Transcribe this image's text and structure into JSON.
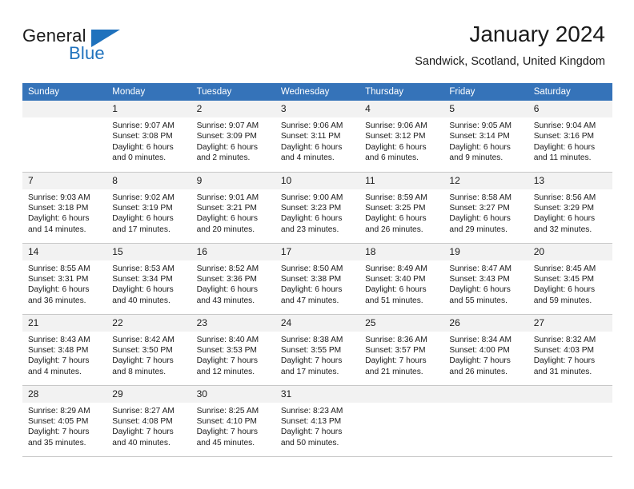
{
  "brand": {
    "name_part1": "General",
    "name_part2": "Blue",
    "flag_icon": "triangle-flag-icon"
  },
  "header": {
    "month_title": "January 2024",
    "location": "Sandwick, Scotland, United Kingdom"
  },
  "colors": {
    "header_blue": "#3573b9",
    "brand_blue": "#1f72bd",
    "daynum_bg": "#f2f2f2",
    "grid_line": "#c8c8c8",
    "text": "#1a1a1a"
  },
  "calendar": {
    "weekday_headers": [
      "Sunday",
      "Monday",
      "Tuesday",
      "Wednesday",
      "Thursday",
      "Friday",
      "Saturday"
    ],
    "weeks": [
      [
        {
          "day": "",
          "sunrise": "",
          "sunset": "",
          "daylight_line1": "",
          "daylight_line2": ""
        },
        {
          "day": "1",
          "sunrise": "Sunrise: 9:07 AM",
          "sunset": "Sunset: 3:08 PM",
          "daylight_line1": "Daylight: 6 hours",
          "daylight_line2": "and 0 minutes."
        },
        {
          "day": "2",
          "sunrise": "Sunrise: 9:07 AM",
          "sunset": "Sunset: 3:09 PM",
          "daylight_line1": "Daylight: 6 hours",
          "daylight_line2": "and 2 minutes."
        },
        {
          "day": "3",
          "sunrise": "Sunrise: 9:06 AM",
          "sunset": "Sunset: 3:11 PM",
          "daylight_line1": "Daylight: 6 hours",
          "daylight_line2": "and 4 minutes."
        },
        {
          "day": "4",
          "sunrise": "Sunrise: 9:06 AM",
          "sunset": "Sunset: 3:12 PM",
          "daylight_line1": "Daylight: 6 hours",
          "daylight_line2": "and 6 minutes."
        },
        {
          "day": "5",
          "sunrise": "Sunrise: 9:05 AM",
          "sunset": "Sunset: 3:14 PM",
          "daylight_line1": "Daylight: 6 hours",
          "daylight_line2": "and 9 minutes."
        },
        {
          "day": "6",
          "sunrise": "Sunrise: 9:04 AM",
          "sunset": "Sunset: 3:16 PM",
          "daylight_line1": "Daylight: 6 hours",
          "daylight_line2": "and 11 minutes."
        }
      ],
      [
        {
          "day": "7",
          "sunrise": "Sunrise: 9:03 AM",
          "sunset": "Sunset: 3:18 PM",
          "daylight_line1": "Daylight: 6 hours",
          "daylight_line2": "and 14 minutes."
        },
        {
          "day": "8",
          "sunrise": "Sunrise: 9:02 AM",
          "sunset": "Sunset: 3:19 PM",
          "daylight_line1": "Daylight: 6 hours",
          "daylight_line2": "and 17 minutes."
        },
        {
          "day": "9",
          "sunrise": "Sunrise: 9:01 AM",
          "sunset": "Sunset: 3:21 PM",
          "daylight_line1": "Daylight: 6 hours",
          "daylight_line2": "and 20 minutes."
        },
        {
          "day": "10",
          "sunrise": "Sunrise: 9:00 AM",
          "sunset": "Sunset: 3:23 PM",
          "daylight_line1": "Daylight: 6 hours",
          "daylight_line2": "and 23 minutes."
        },
        {
          "day": "11",
          "sunrise": "Sunrise: 8:59 AM",
          "sunset": "Sunset: 3:25 PM",
          "daylight_line1": "Daylight: 6 hours",
          "daylight_line2": "and 26 minutes."
        },
        {
          "day": "12",
          "sunrise": "Sunrise: 8:58 AM",
          "sunset": "Sunset: 3:27 PM",
          "daylight_line1": "Daylight: 6 hours",
          "daylight_line2": "and 29 minutes."
        },
        {
          "day": "13",
          "sunrise": "Sunrise: 8:56 AM",
          "sunset": "Sunset: 3:29 PM",
          "daylight_line1": "Daylight: 6 hours",
          "daylight_line2": "and 32 minutes."
        }
      ],
      [
        {
          "day": "14",
          "sunrise": "Sunrise: 8:55 AM",
          "sunset": "Sunset: 3:31 PM",
          "daylight_line1": "Daylight: 6 hours",
          "daylight_line2": "and 36 minutes."
        },
        {
          "day": "15",
          "sunrise": "Sunrise: 8:53 AM",
          "sunset": "Sunset: 3:34 PM",
          "daylight_line1": "Daylight: 6 hours",
          "daylight_line2": "and 40 minutes."
        },
        {
          "day": "16",
          "sunrise": "Sunrise: 8:52 AM",
          "sunset": "Sunset: 3:36 PM",
          "daylight_line1": "Daylight: 6 hours",
          "daylight_line2": "and 43 minutes."
        },
        {
          "day": "17",
          "sunrise": "Sunrise: 8:50 AM",
          "sunset": "Sunset: 3:38 PM",
          "daylight_line1": "Daylight: 6 hours",
          "daylight_line2": "and 47 minutes."
        },
        {
          "day": "18",
          "sunrise": "Sunrise: 8:49 AM",
          "sunset": "Sunset: 3:40 PM",
          "daylight_line1": "Daylight: 6 hours",
          "daylight_line2": "and 51 minutes."
        },
        {
          "day": "19",
          "sunrise": "Sunrise: 8:47 AM",
          "sunset": "Sunset: 3:43 PM",
          "daylight_line1": "Daylight: 6 hours",
          "daylight_line2": "and 55 minutes."
        },
        {
          "day": "20",
          "sunrise": "Sunrise: 8:45 AM",
          "sunset": "Sunset: 3:45 PM",
          "daylight_line1": "Daylight: 6 hours",
          "daylight_line2": "and 59 minutes."
        }
      ],
      [
        {
          "day": "21",
          "sunrise": "Sunrise: 8:43 AM",
          "sunset": "Sunset: 3:48 PM",
          "daylight_line1": "Daylight: 7 hours",
          "daylight_line2": "and 4 minutes."
        },
        {
          "day": "22",
          "sunrise": "Sunrise: 8:42 AM",
          "sunset": "Sunset: 3:50 PM",
          "daylight_line1": "Daylight: 7 hours",
          "daylight_line2": "and 8 minutes."
        },
        {
          "day": "23",
          "sunrise": "Sunrise: 8:40 AM",
          "sunset": "Sunset: 3:53 PM",
          "daylight_line1": "Daylight: 7 hours",
          "daylight_line2": "and 12 minutes."
        },
        {
          "day": "24",
          "sunrise": "Sunrise: 8:38 AM",
          "sunset": "Sunset: 3:55 PM",
          "daylight_line1": "Daylight: 7 hours",
          "daylight_line2": "and 17 minutes."
        },
        {
          "day": "25",
          "sunrise": "Sunrise: 8:36 AM",
          "sunset": "Sunset: 3:57 PM",
          "daylight_line1": "Daylight: 7 hours",
          "daylight_line2": "and 21 minutes."
        },
        {
          "day": "26",
          "sunrise": "Sunrise: 8:34 AM",
          "sunset": "Sunset: 4:00 PM",
          "daylight_line1": "Daylight: 7 hours",
          "daylight_line2": "and 26 minutes."
        },
        {
          "day": "27",
          "sunrise": "Sunrise: 8:32 AM",
          "sunset": "Sunset: 4:03 PM",
          "daylight_line1": "Daylight: 7 hours",
          "daylight_line2": "and 31 minutes."
        }
      ],
      [
        {
          "day": "28",
          "sunrise": "Sunrise: 8:29 AM",
          "sunset": "Sunset: 4:05 PM",
          "daylight_line1": "Daylight: 7 hours",
          "daylight_line2": "and 35 minutes."
        },
        {
          "day": "29",
          "sunrise": "Sunrise: 8:27 AM",
          "sunset": "Sunset: 4:08 PM",
          "daylight_line1": "Daylight: 7 hours",
          "daylight_line2": "and 40 minutes."
        },
        {
          "day": "30",
          "sunrise": "Sunrise: 8:25 AM",
          "sunset": "Sunset: 4:10 PM",
          "daylight_line1": "Daylight: 7 hours",
          "daylight_line2": "and 45 minutes."
        },
        {
          "day": "31",
          "sunrise": "Sunrise: 8:23 AM",
          "sunset": "Sunset: 4:13 PM",
          "daylight_line1": "Daylight: 7 hours",
          "daylight_line2": "and 50 minutes."
        },
        {
          "day": "",
          "sunrise": "",
          "sunset": "",
          "daylight_line1": "",
          "daylight_line2": ""
        },
        {
          "day": "",
          "sunrise": "",
          "sunset": "",
          "daylight_line1": "",
          "daylight_line2": ""
        },
        {
          "day": "",
          "sunrise": "",
          "sunset": "",
          "daylight_line1": "",
          "daylight_line2": ""
        }
      ]
    ]
  }
}
